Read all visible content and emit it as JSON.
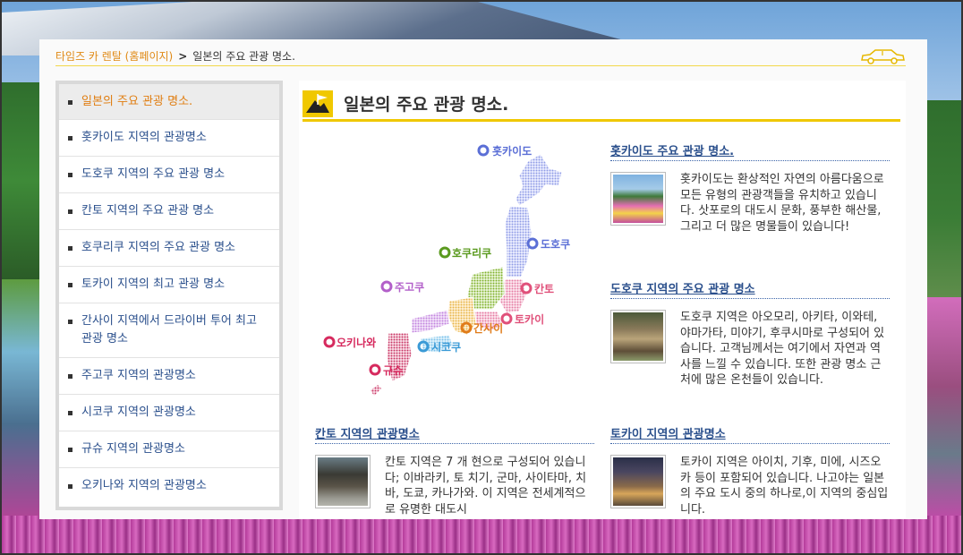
{
  "breadcrumb": {
    "home": "타임즈 카 렌탈 (홈페이지)",
    "separator": ">",
    "current": "일본의 주요 관광 명소."
  },
  "sidebar": {
    "items": [
      {
        "label": "일본의 주요 관광 명소.",
        "active": true
      },
      {
        "label": "홋카이도 지역의 관광명소"
      },
      {
        "label": "도호쿠 지역의 주요 관광 명소"
      },
      {
        "label": "칸토 지역의 주요 관광 명소"
      },
      {
        "label": "호쿠리쿠 지역의 주요 관광 명소"
      },
      {
        "label": "토카이 지역의 최고 관광 명소"
      },
      {
        "label": "간사이 지역에서 드라이버 투어 최고 관광 명소"
      },
      {
        "label": "주고쿠 지역의 관광명소"
      },
      {
        "label": "시코쿠 지역의 관광명소"
      },
      {
        "label": "규슈 지역의 관광명소"
      },
      {
        "label": "오키나와 지역의 관광명소"
      }
    ]
  },
  "content": {
    "title": "일본의 주요 관광 명소."
  },
  "map": {
    "labels": {
      "hokkaido": "홋카이도",
      "tohoku": "도호쿠",
      "hokuriku": "호쿠리쿠",
      "kanto": "칸토",
      "chugoku": "주고쿠",
      "tokai": "토카이",
      "kansai": "간사이",
      "okinawa": "오키나와",
      "shikoku": "시코쿠",
      "kyushu": "규슈"
    },
    "colors": {
      "hokkaido": "#5b6fd6",
      "tohoku": "#5b6fd6",
      "hokuriku": "#5a9a1e",
      "kanto": "#e0507a",
      "chugoku": "#b25fc9",
      "tokai": "#e0507a",
      "kansai": "#e07c1a",
      "okinawa": "#d62a5e",
      "shikoku": "#3a9ad6",
      "kyushu": "#d62a5e"
    }
  },
  "sections": {
    "hokkaido": {
      "heading": "홋카이도 주요 관광 명소.",
      "text": "홋카이도는 환상적인 자연의 아름다움으로 모든 유형의 관광객들을 유치하고 있습니다. 삿포로의 대도시 문화, 풍부한 해산물, 그리고 더 많은 명물들이 있습니다!"
    },
    "tohoku": {
      "heading": "도호쿠 지역의 주요 관광 명소",
      "text": "도호쿠 지역은 아오모리, 아키타, 이와테, 야마가타, 미야기, 후쿠시마로 구성되어 있습니다. 고객님께서는 여기에서 자연과 역사를 느낄 수 있습니다. 또한 관광 명소 근처에 많은 온천들이 있습니다."
    },
    "kanto": {
      "heading": "칸토 지역의 관광명소",
      "text": "칸토 지역은 7 개 현으로 구성되어 있습니다; 이바라키, 토 치기, 군마, 사이타마, 치바, 도쿄, 카나가와. 이 지역은 전세계적으로 유명한 대도시"
    },
    "tokai": {
      "heading": "토카이 지역의 관광명소",
      "text": "토카이 지역은 아이치, 기후, 미에, 시즈오카 등이 포함되어 있습니다. 나고야는 일본의 주요 도시 중의 하나로,이 지역의 중심입니다."
    }
  },
  "colors": {
    "accent_yellow": "#f0c800",
    "active_orange": "#e07e12",
    "link_blue": "#2a4f8c"
  }
}
